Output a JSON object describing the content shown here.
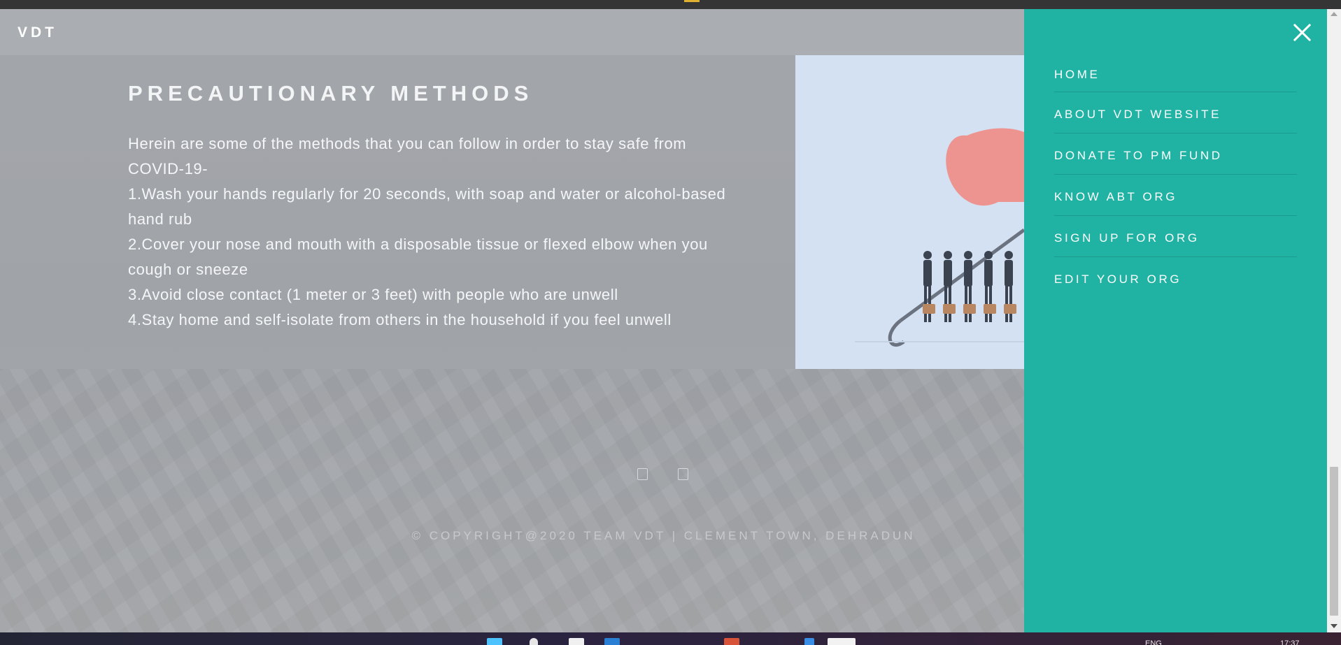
{
  "site": {
    "brand": "VDT"
  },
  "content": {
    "title": "PRECAUTIONARY METHODS",
    "paragraphs": [
      "Herein are some of the methods that you can follow in order to stay safe from COVID-19-",
      "1.Wash your hands regularly for 20 seconds, with soap and water or alcohol-based hand rub",
      "2.Cover your nose and mouth with a disposable tissue or flexed elbow when you cough or sneeze",
      "3.Avoid close contact (1 meter or 3 feet) with people who are unwell",
      "4.Stay home and self-isolate from others in the household if you feel unwell"
    ]
  },
  "footer": {
    "copyright": "© COPYRIGHT@2020 TEAM VDT  |  CLEMENT TOWN, DEHRADUN"
  },
  "menu": {
    "items": [
      {
        "label": "HOME"
      },
      {
        "label": "ABOUT VDT WEBSITE"
      },
      {
        "label": "DONATE TO PM FUND"
      },
      {
        "label": "KNOW ABT ORG"
      },
      {
        "label": "SIGN UP FOR ORG"
      },
      {
        "label": "EDIT YOUR ORG"
      }
    ]
  },
  "taskbar": {
    "language": "ENG",
    "time": "17:37"
  },
  "colors": {
    "menu_background": "#20b3a4",
    "page_overlay": "#a3a6aa",
    "illustration_background": "#d3e1f2",
    "umbrella": "#ee8f8a"
  },
  "icons": [
    "close-icon",
    "social-icon",
    "umbrella-illustration"
  ]
}
